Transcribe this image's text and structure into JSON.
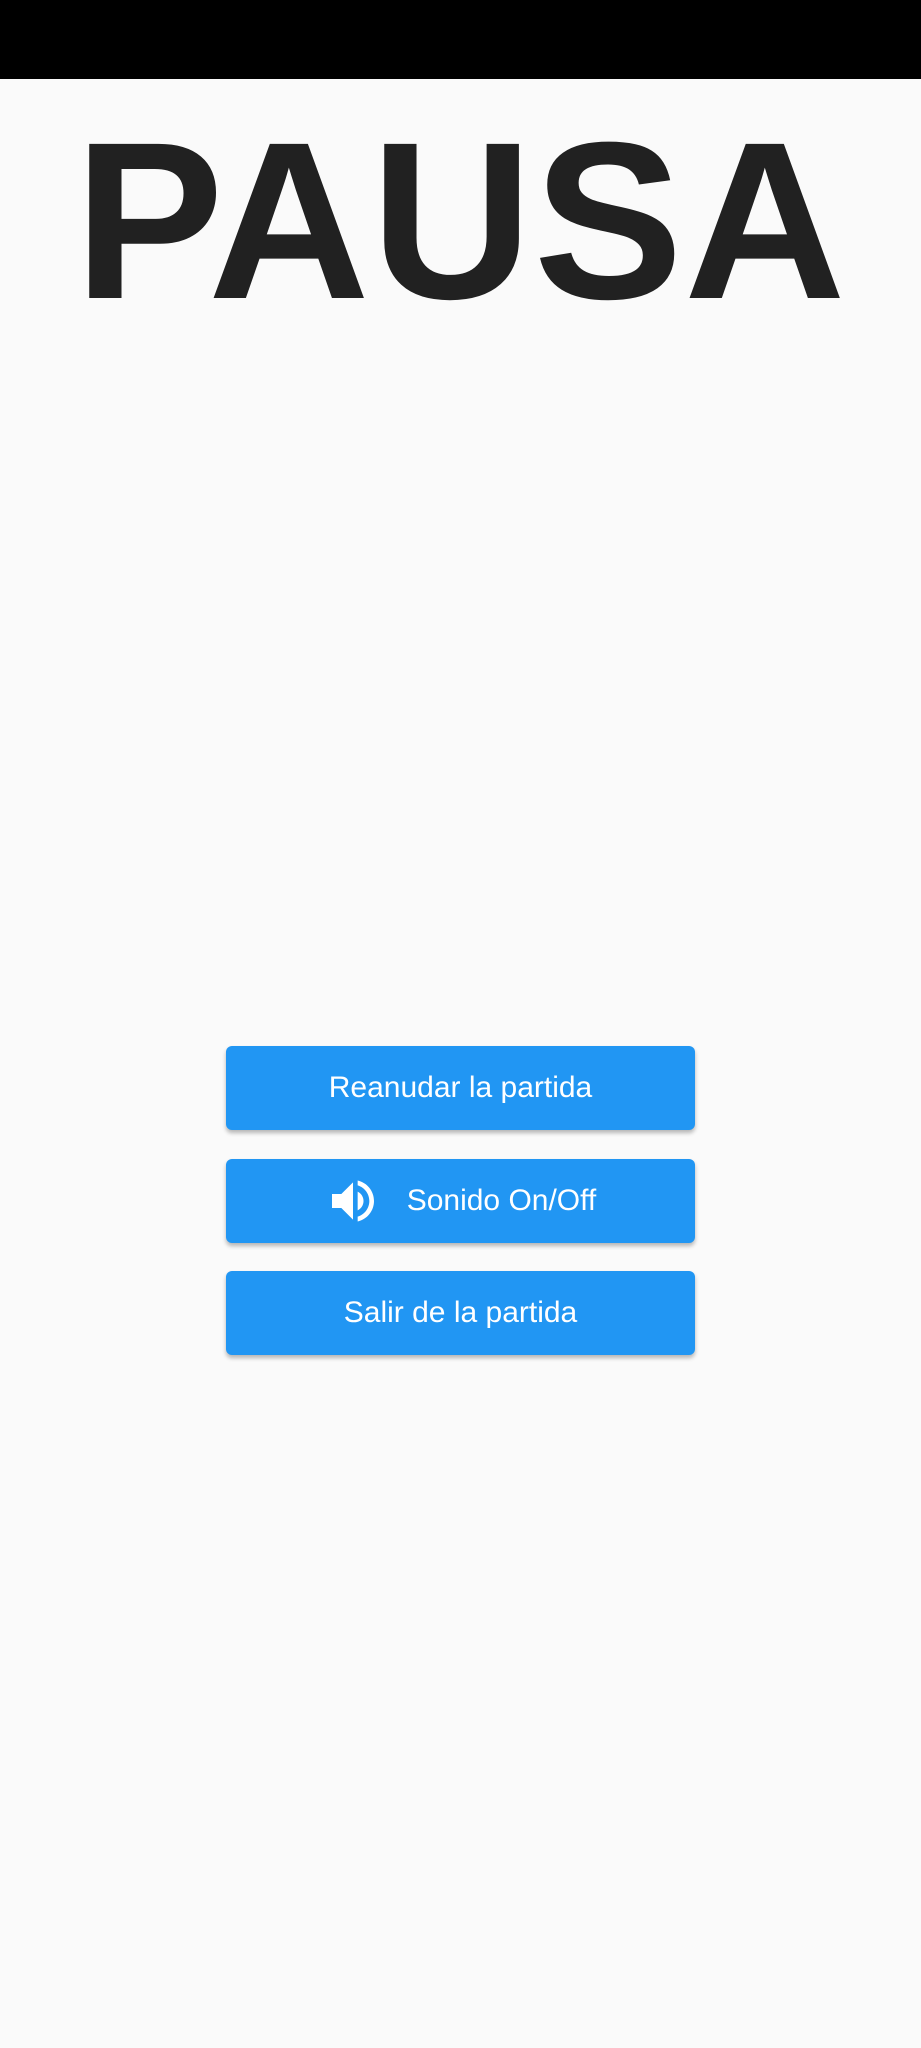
{
  "title": "PAUSA",
  "buttons": {
    "resume_label": "Reanudar la partida",
    "sound_label": "Sonido On/Off",
    "sound_icon": "volume-up-icon",
    "exit_label": "Salir de la partida"
  },
  "colors": {
    "background": "#fafafa",
    "status_bar": "#000000",
    "title": "#212121",
    "button": "#2196f3",
    "button_text": "#ffffff"
  }
}
